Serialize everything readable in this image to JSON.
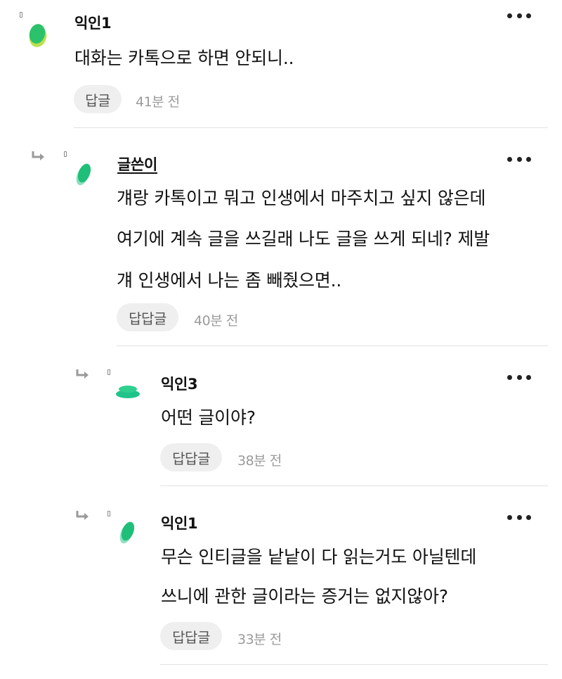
{
  "comments": [
    {
      "author": "익인1",
      "lines": [
        "대화는 카톡으로 하면 안되니.."
      ],
      "reply_label": "답글",
      "time": "41분 전",
      "is_reply": false,
      "author_underlined": false
    },
    {
      "author": "글쓴이",
      "lines": [
        "걔랑 카톡이고 뭐고 인생에서 마주치고 싶지 않은데",
        "여기에 계속 글을 쓰길래 나도 글을 쓰게 되네? 제발",
        "걔 인생에서 나는 좀 빼줬으면.."
      ],
      "reply_label": "답답글",
      "time": "40분 전",
      "is_reply": true,
      "author_underlined": true
    },
    {
      "author": "익인3",
      "lines": [
        "어떤 글이야?"
      ],
      "reply_label": "답답글",
      "time": "38분 전",
      "is_reply": true,
      "author_underlined": false
    },
    {
      "author": "익인1",
      "lines": [
        "무슨 인티글을 낱낱이 다 읽는거도 아닐텐데",
        "쓰니에 관한 글이라는 증거는 없지않아?"
      ],
      "reply_label": "답답글",
      "time": "33분 전",
      "is_reply": true,
      "author_underlined": false
    }
  ],
  "icons": {
    "more": "more-options-icon",
    "reply_arrow": "reply-arrow-icon",
    "avatar": "avatar-icon"
  },
  "colors": {
    "avatar_green": "#2ecc71",
    "avatar_light": "#a8e063",
    "avatar_teal": "#1abc9c",
    "button_bg": "#efefef",
    "time_gray": "#9b9b9b"
  }
}
